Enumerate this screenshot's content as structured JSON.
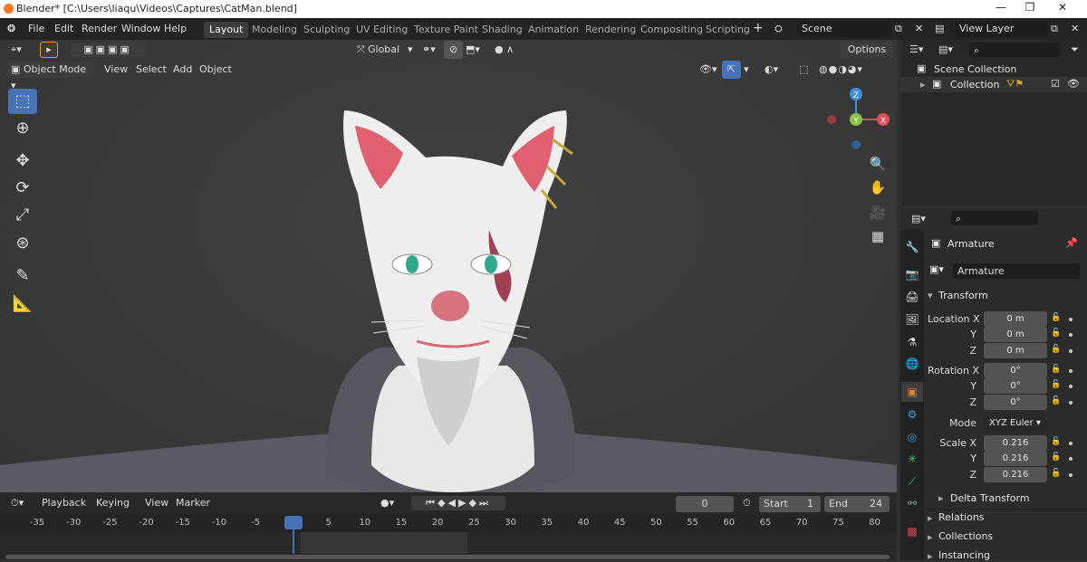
{
  "window": {
    "title": "Blender* [C:\\Users\\liaqu\\Videos\\Captures\\CatMan.blend]",
    "min": "—",
    "max": "❐",
    "close": "✕"
  },
  "menu": {
    "items": [
      "File",
      "Edit",
      "Render",
      "Window",
      "Help"
    ]
  },
  "workspaces": [
    "Layout",
    "Modeling",
    "Sculpting",
    "UV Editing",
    "Texture Paint",
    "Shading",
    "Animation",
    "Rendering",
    "Compositing",
    "Scripting"
  ],
  "add_workspace": "+",
  "scene": {
    "name": "Scene",
    "layer": "View Layer"
  },
  "viewport": {
    "transform": "Global",
    "options": "Options",
    "mode": "Object Mode",
    "menus": [
      "View",
      "Select",
      "Add",
      "Object"
    ]
  },
  "gizmo": {
    "z": "Z",
    "y": "Y",
    "x": "X"
  },
  "timeline": {
    "menus": [
      "Playback",
      "Keying",
      "View",
      "Marker"
    ],
    "current": "0",
    "start_label": "Start",
    "start": "1",
    "end_label": "End",
    "end": "24",
    "ticks": [
      "-35",
      "-30",
      "-25",
      "-20",
      "-15",
      "-10",
      "-5",
      "0",
      "5",
      "10",
      "15",
      "20",
      "25",
      "30",
      "35",
      "40",
      "45",
      "50",
      "55",
      "60",
      "65",
      "70",
      "75",
      "80"
    ]
  },
  "outliner": {
    "root": "Scene Collection",
    "collection": "Collection"
  },
  "properties": {
    "object": "Armature",
    "data": "Armature",
    "transform": "Transform",
    "location_label": "Location X",
    "y": "Y",
    "z": "Z",
    "loc": [
      "0 m",
      "0 m",
      "0 m"
    ],
    "rotation_label": "Rotation X",
    "rot": [
      "0°",
      "0°",
      "0°"
    ],
    "mode_label": "Mode",
    "mode": "XYZ Euler",
    "scale_label": "Scale X",
    "scale": [
      "0.216",
      "0.216",
      "0.216"
    ],
    "delta": "Delta Transform",
    "relations": "Relations",
    "collections": "Collections",
    "instancing": "Instancing"
  },
  "colors": {
    "accent": "#4772b3",
    "x_axis": "#e44d5e",
    "y_axis": "#8bc34a",
    "z_axis": "#3d8fe0"
  }
}
